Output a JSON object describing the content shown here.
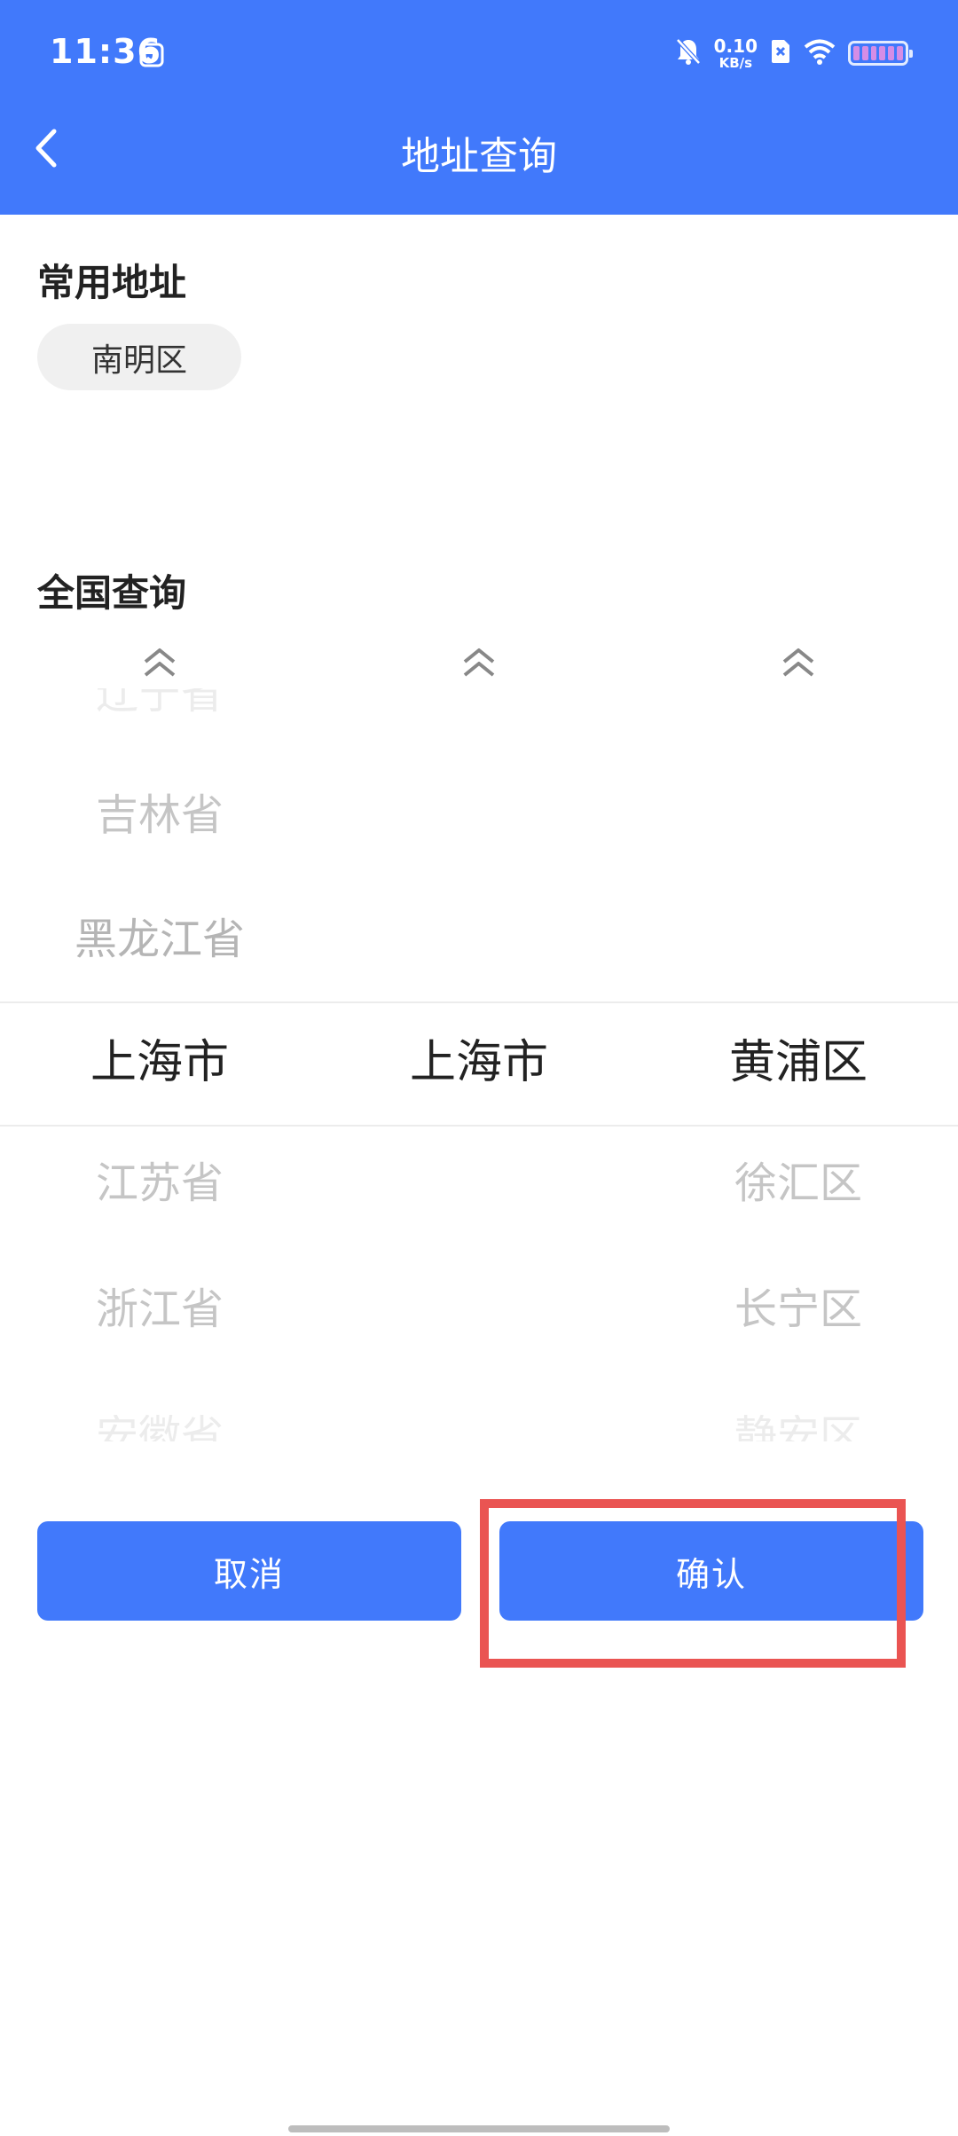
{
  "status_bar": {
    "time": "11:36",
    "net_speed_value": "0.10",
    "net_speed_unit": "KB/s",
    "icons": [
      "app-icon",
      "bell-muted-icon",
      "sim-x-icon",
      "wifi-icon",
      "battery-icon"
    ]
  },
  "nav": {
    "title": "地址查询",
    "back_icon": "chevron-left-icon"
  },
  "common": {
    "title": "常用地址",
    "chips": [
      "南明区"
    ]
  },
  "national": {
    "title": "全国查询"
  },
  "picker": {
    "province": [
      "辽宁省",
      "吉林省",
      "黑龙江省",
      "上海市",
      "江苏省",
      "浙江省",
      "安徽省"
    ],
    "city": [
      "上海市"
    ],
    "district": [
      "黄浦区",
      "徐汇区",
      "长宁区",
      "静安区"
    ]
  },
  "actions": {
    "cancel": "取消",
    "confirm": "确认"
  },
  "colors": {
    "primary": "#4179fb",
    "highlight": "#ea5452"
  }
}
